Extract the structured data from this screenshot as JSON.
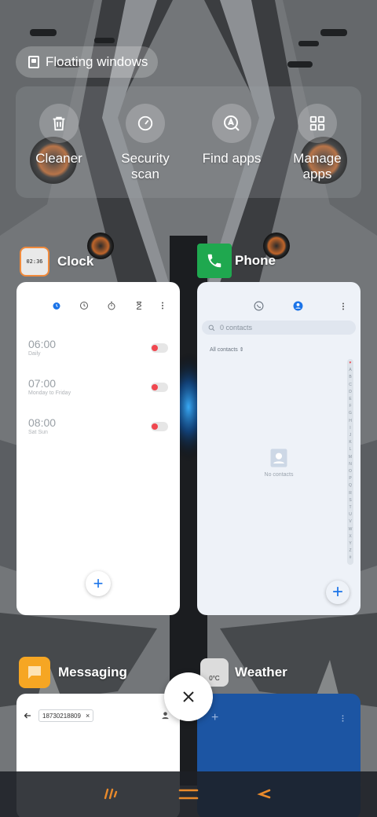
{
  "floating_windows": {
    "label": "Floating windows",
    "icon": "floating-window-icon"
  },
  "quick_actions": [
    {
      "label": "Cleaner",
      "icon": "trash-icon"
    },
    {
      "label": "Security\nscan",
      "line1": "Security",
      "line2": "scan",
      "icon": "security-gauge-icon"
    },
    {
      "label": "Find apps",
      "icon": "find-apps-icon"
    },
    {
      "label": "Manage\napps",
      "line1": "Manage",
      "line2": "apps",
      "icon": "grid-icon"
    }
  ],
  "apps": {
    "clock": {
      "title": "Clock",
      "icon_text": "02:36",
      "alarms": [
        {
          "time": "06:00",
          "repeat": "Daily"
        },
        {
          "time": "07:00",
          "repeat": "Monday to Friday"
        },
        {
          "time": "08:00",
          "repeat": "Sat Sun"
        }
      ]
    },
    "phone": {
      "title": "Phone",
      "search_placeholder": "0 contacts",
      "filter_label": "All contacts",
      "empty_text": "No contacts",
      "alphabet": [
        "♥",
        "A",
        "B",
        "C",
        "D",
        "E",
        "F",
        "G",
        "H",
        "I",
        "J",
        "K",
        "L",
        "M",
        "N",
        "O",
        "P",
        "Q",
        "R",
        "S",
        "T",
        "U",
        "V",
        "W",
        "X",
        "Y",
        "Z",
        "#"
      ]
    },
    "messaging": {
      "title": "Messaging",
      "recipient": "18730218809"
    },
    "weather": {
      "title": "Weather",
      "icon_text": "0°C"
    }
  },
  "colors": {
    "accent_blue": "#1a73e8",
    "phone_green": "#1fa84f",
    "messaging_orange": "#f6a623",
    "toggle_red": "#f0474f",
    "nav_orange": "#e98a2b"
  }
}
